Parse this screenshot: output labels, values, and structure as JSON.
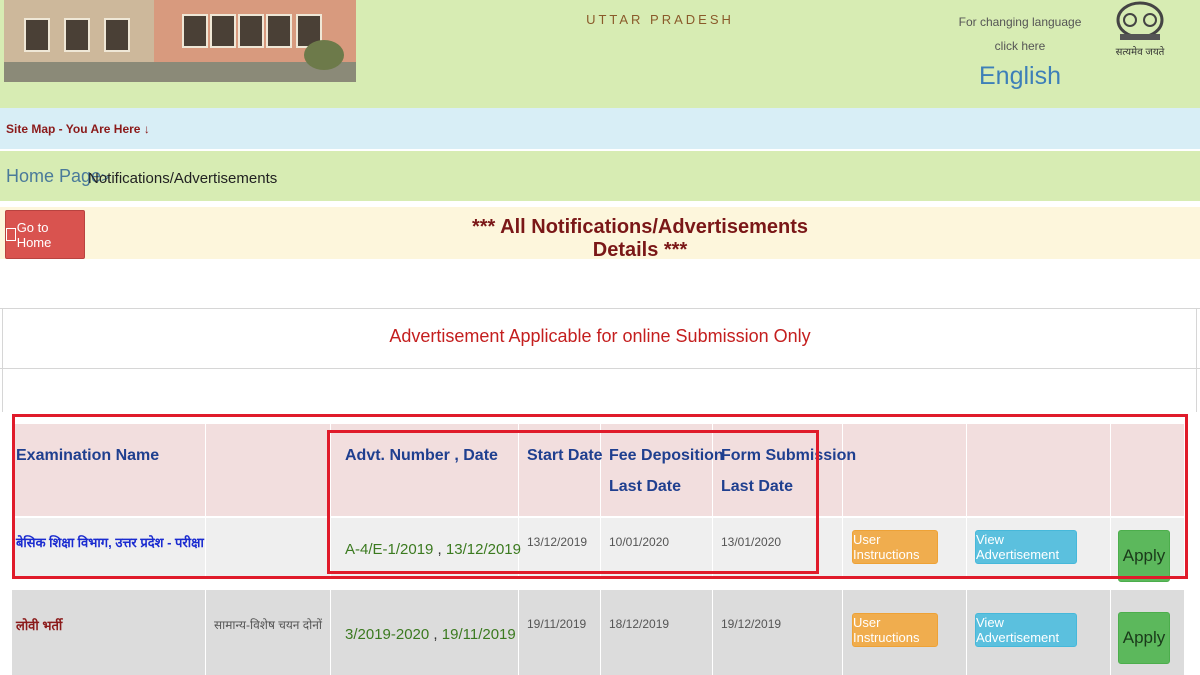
{
  "header": {
    "state_name": "UTTAR PRADESH",
    "language_note_line1": "For changing language",
    "language_note_line2": "click here",
    "language_link": "English",
    "emblem_text": "सत्यमेव जयते"
  },
  "sitemap": {
    "text": "Site Map - You Are Here ↓"
  },
  "breadcrumb": {
    "home": "Home Page",
    "separator": ">",
    "current": "Notifications/Advertisements"
  },
  "toolbar": {
    "home_button_label": "Go to Home"
  },
  "page_heading": "*** All Notifications/Advertisements Details ***",
  "applicable_note": "Advertisement Applicable for online Submission Only",
  "table": {
    "headers": {
      "exam_name": "Examination Name",
      "advt": "Advt. Number , Date",
      "start": "Start Date",
      "fee_line1": "Fee Deposition",
      "fee_line2": "Last Date",
      "form_line1": "Form Submission",
      "form_line2": "Last Date"
    },
    "rows": [
      {
        "exam_name": "बेसिक शिक्षा विभाग, उत्तर प्रदेश - परीक्षा",
        "type": "",
        "advt_number": "A-4/E-1/2019",
        "advt_sep": " , ",
        "advt_date": "13/12/2019",
        "start_date": "13/12/2019",
        "fee_last_date": "10/01/2020",
        "form_last_date": "13/01/2020",
        "instructions_label": "User Instructions",
        "view_label": "View Advertisement",
        "apply_label": "Apply"
      },
      {
        "exam_name": "लोवी भर्ती",
        "type": "सामान्य-विशेष चयन दोनों",
        "advt_number": "3/2019-2020",
        "advt_sep": " , ",
        "advt_date": "19/11/2019",
        "start_date": "19/11/2019",
        "fee_last_date": "18/12/2019",
        "form_last_date": "19/12/2019",
        "instructions_label": "User Instructions",
        "view_label": "View Advertisement",
        "apply_label": "Apply"
      }
    ]
  },
  "colors": {
    "header_bg": "#d7ecb3",
    "sitemap_bg": "#d8eef6",
    "heading_red": "#7a1717",
    "highlight_red": "#e01b2a",
    "header_row_bg": "#f2dede"
  }
}
